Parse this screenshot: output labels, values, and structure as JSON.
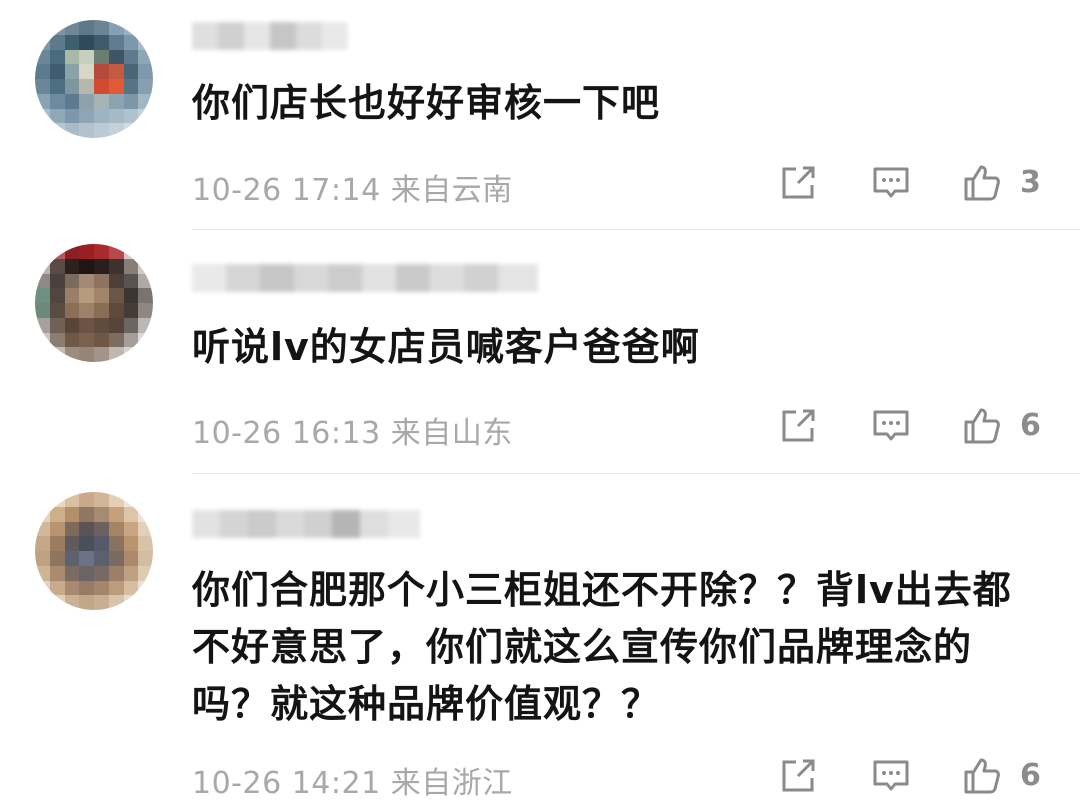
{
  "comments": [
    {
      "text": "你们店长也好好审核一下吧",
      "time": "10-26 17:14",
      "location": "来自云南",
      "likes": "3"
    },
    {
      "text": "听说lv的女店员喊客户爸爸啊",
      "time": "10-26 16:13",
      "location": "来自山东",
      "likes": "6"
    },
    {
      "text": "你们合肥那个小三柜姐还不开除？？背lv出去都不好意思了，你们就这么宣传你们品牌理念的吗？就这种品牌价值观？？",
      "time": "10-26 14:21",
      "location": "来自浙江",
      "likes": "6"
    }
  ],
  "icons": {
    "share": "share-icon",
    "reply": "comment-icon",
    "like": "thumbs-up-icon"
  },
  "colors": {
    "meta_text": "#a8a8a8",
    "icon_stroke": "#8a8a8a",
    "divider": "#e6e6e6"
  }
}
